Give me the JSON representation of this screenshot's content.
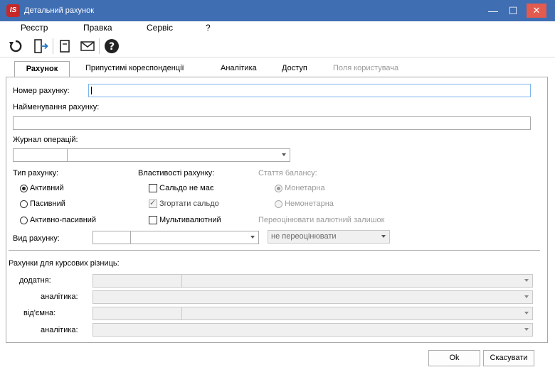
{
  "window": {
    "title": "Детальний рахунок",
    "logo_text": "IS"
  },
  "menu": [
    "Реєстр",
    "Правка",
    "Сервіс",
    "?"
  ],
  "toolbar": {
    "icons": [
      "refresh-icon",
      "exit-icon",
      "document-icon",
      "mail-icon",
      "help-icon"
    ]
  },
  "tabs": {
    "active": "Рахунок",
    "others": [
      "Припустимі кореспонденції",
      "Аналітика",
      "Доступ"
    ],
    "disabled": "Поля користувача"
  },
  "form": {
    "number_label": "Номер рахунку:",
    "number_value": "",
    "name_label": "Найменування рахунку:",
    "name_value": "",
    "journal_label": "Журнал операцій:",
    "journal_code": "",
    "journal_value": "",
    "account_type": {
      "label": "Тип рахунку:",
      "options": [
        "Активний",
        "Пасивний",
        "Активно-пасивний"
      ],
      "selected": "Активний"
    },
    "properties": {
      "label": "Властивості рахунку:",
      "items": [
        {
          "label": "Сальдо не має",
          "checked": false,
          "enabled": true
        },
        {
          "label": "Згортати сальдо",
          "checked": true,
          "enabled": false
        },
        {
          "label": "Мультивалютний",
          "checked": false,
          "enabled": true
        }
      ]
    },
    "balance_item": {
      "label": "Стаття балансу:",
      "options": [
        "Монетарна",
        "Немонетарна"
      ],
      "selected": "Монетарна"
    },
    "revalue": {
      "label": "Переоцінювати валютний залишок",
      "value": "не переоцінювати"
    },
    "kind_label": "Вид рахунку:",
    "kind_code": "",
    "kind_value": ""
  },
  "exchange": {
    "heading": "Рахунки для курсових різниць:",
    "positive_label": "додатня:",
    "positive_analytics_label": "аналітика:",
    "negative_label": "від'ємна:",
    "negative_analytics_label": "аналітика:"
  },
  "buttons": {
    "ok": "Ok",
    "cancel": "Скасувати"
  }
}
